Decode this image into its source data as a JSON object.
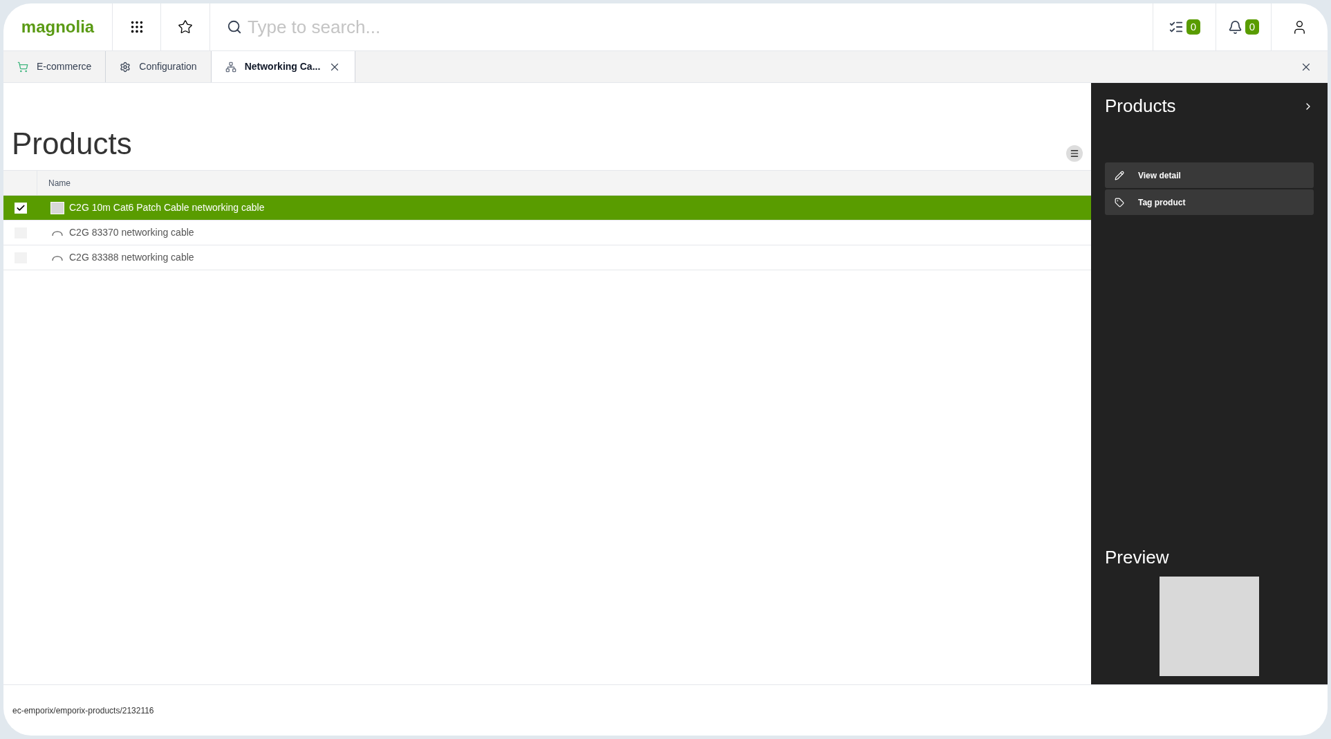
{
  "header": {
    "logo": "magnolia",
    "search": {
      "placeholder": "Type to search..."
    },
    "tasks_count": "0",
    "notifications_count": "0"
  },
  "tabs": [
    {
      "label": "E-commerce",
      "kind": "cart",
      "selected": false,
      "closable": false
    },
    {
      "label": "Configuration",
      "kind": "gear",
      "selected": false,
      "closable": false
    },
    {
      "label": "Networking Ca...",
      "kind": "tree",
      "selected": true,
      "closable": true
    }
  ],
  "page_title": "Products",
  "table": {
    "columns": [
      "Name"
    ],
    "rows": [
      {
        "name": "C2G 10m Cat6 Patch Cable networking cable",
        "kind": "image",
        "selected": true
      },
      {
        "name": "C2G 83370 networking cable",
        "kind": "cable",
        "selected": false
      },
      {
        "name": "C2G 83388 networking cable",
        "kind": "cable",
        "selected": false
      }
    ]
  },
  "actions_panel": {
    "title": "Products",
    "actions": [
      {
        "label": "View detail",
        "kind": "edit"
      },
      {
        "label": "Tag product",
        "kind": "tag"
      }
    ],
    "preview_title": "Preview"
  },
  "status_bar": "ec-emporix/emporix-products/2132116"
}
